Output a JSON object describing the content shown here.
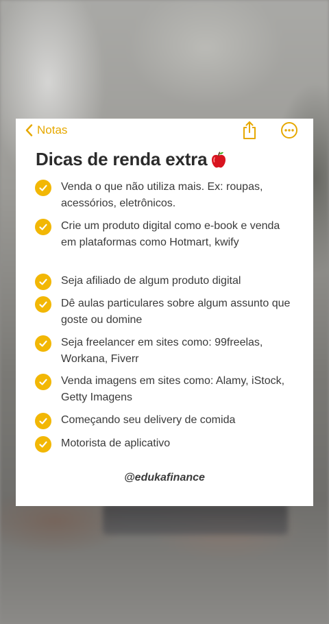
{
  "nav": {
    "back_label": "Notas",
    "accent_color": "#e6a800",
    "share_icon": "share-icon",
    "more_icon": "ellipsis-circle-icon"
  },
  "note": {
    "title": "Dicas de renda extra",
    "title_emoji": "apple-icon",
    "check_color": "#f2b705",
    "items": [
      {
        "text": "Venda o que não utiliza mais. Ex: roupas, acessórios, eletrônicos."
      },
      {
        "text": "Crie um produto digital como e-book e venda em plataformas como Hotmart, kwify"
      },
      {
        "text": "Seja afiliado de algum produto digital"
      },
      {
        "text": "Dê aulas particulares sobre algum assunto que goste ou domine"
      },
      {
        "text": "Seja freelancer em sites como: 99freelas, Workana, Fiverr"
      },
      {
        "text": "Venda imagens em sites como: Alamy, iStock, Getty Imagens"
      },
      {
        "text": "Começando seu delivery de comida"
      },
      {
        "text": "Motorista de aplicativo"
      }
    ],
    "signature": "@edukafinance"
  }
}
